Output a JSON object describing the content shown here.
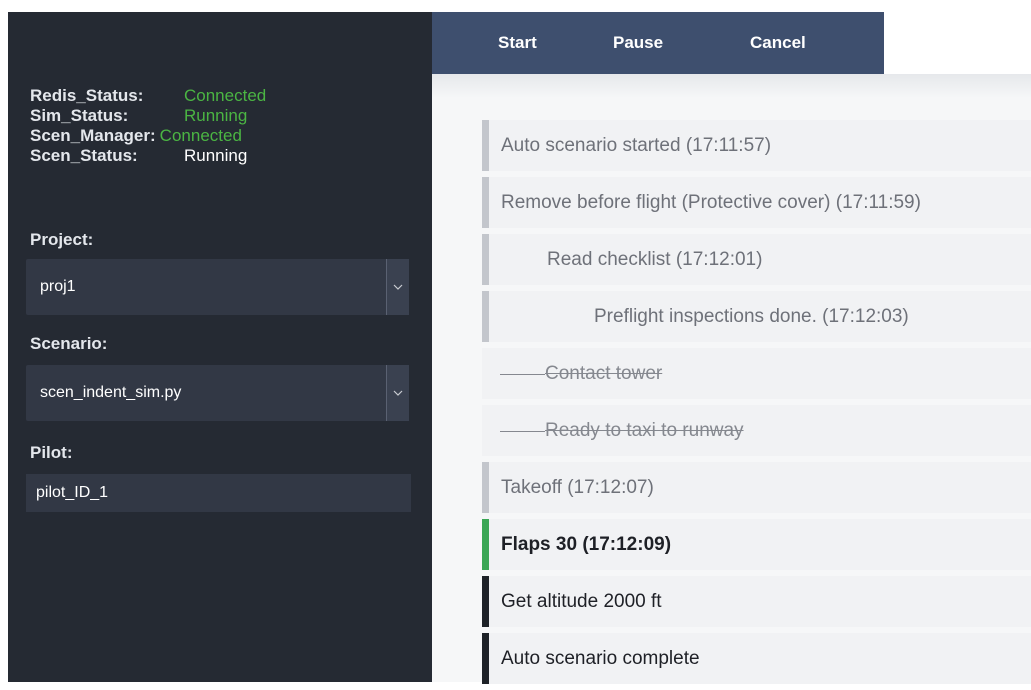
{
  "toolbar": {
    "start_label": "Start",
    "pause_label": "Pause",
    "cancel_label": "Cancel"
  },
  "status": [
    {
      "key": "Redis_Status:",
      "value": "Connected",
      "color": "#4bb543"
    },
    {
      "key": "Sim_Status:",
      "value": "Running",
      "color": "#4bb543"
    },
    {
      "key": "Scen_Manager:",
      "value": "Connected",
      "color": "#4bb543"
    },
    {
      "key": "Scen_Status:",
      "value": "Running",
      "color": "#ffffff"
    }
  ],
  "project": {
    "label": "Project:",
    "value": "proj1"
  },
  "scenario": {
    "label": "Scenario:",
    "value": "scen_indent_sim.py"
  },
  "pilot": {
    "label": "Pilot:",
    "value": "pilot_ID_1"
  },
  "log": [
    {
      "text": "Auto scenario started  (17:11:57)",
      "state": "done",
      "indent": 0
    },
    {
      "text": "Remove before flight (Protective cover)  (17:11:59)",
      "state": "done",
      "indent": 0
    },
    {
      "text": "Read checklist  (17:12:01)",
      "state": "done",
      "indent": 1
    },
    {
      "text": "Preflight inspections done.  (17:12:03)",
      "state": "done",
      "indent": 2
    },
    {
      "text": "Contact tower",
      "state": "skipped",
      "indent": 0
    },
    {
      "text": "Ready to taxi to runway",
      "state": "skipped",
      "indent": 0
    },
    {
      "text": "Takeoff  (17:12:07)",
      "state": "done",
      "indent": 0
    },
    {
      "text": "Flaps 30  (17:12:09)",
      "state": "current",
      "indent": 0
    },
    {
      "text": "Get altitude 2000 ft",
      "state": "pending",
      "indent": 0
    },
    {
      "text": "Auto scenario complete",
      "state": "pending",
      "indent": 0
    }
  ],
  "colors": {
    "sidebar_bg": "#252a33",
    "toolbar_bg": "#3e4f6e",
    "connected": "#4bb543",
    "current_bar": "#3aa655",
    "pending_bar": "#1e2228",
    "done_bar": "#c3c6cc"
  }
}
